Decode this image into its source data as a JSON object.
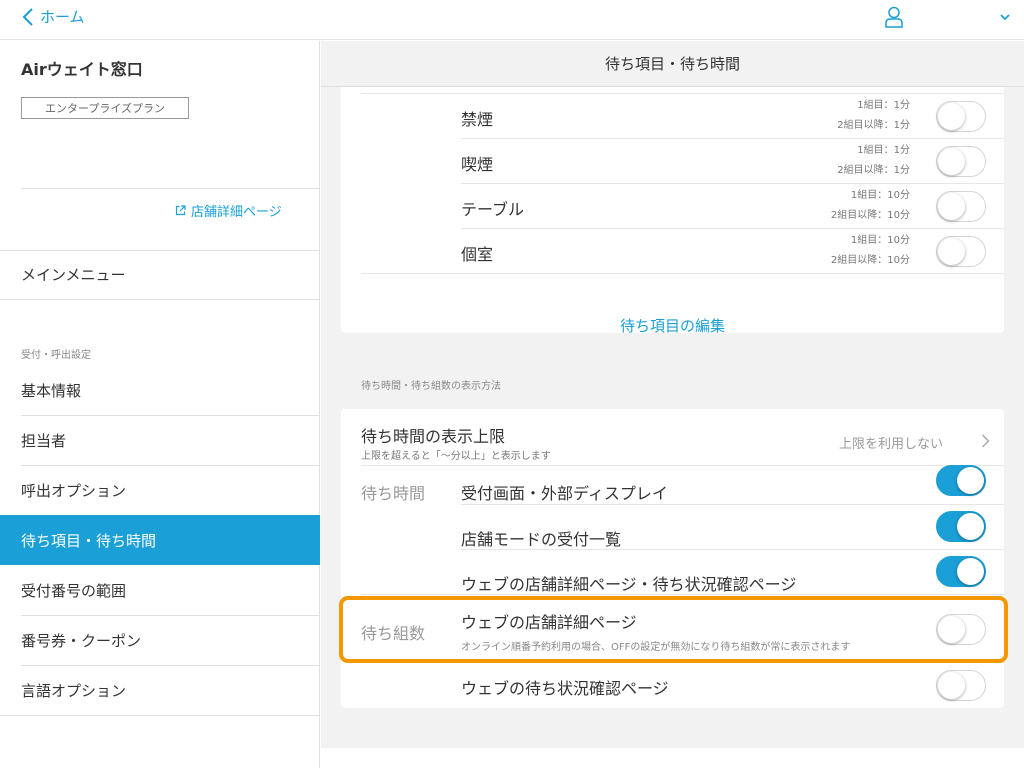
{
  "topbar": {
    "back_label": "ホーム"
  },
  "sidebar": {
    "shop_name": "Airウェイト窓口",
    "plan_badge": "エンタープライズプラン",
    "detail_link": "店舗詳細ページ",
    "main_menu": "メインメニュー",
    "section_label": "受付・呼出設定",
    "items": [
      {
        "label": "基本情報"
      },
      {
        "label": "担当者"
      },
      {
        "label": "呼出オプション"
      },
      {
        "label": "待ち項目・待ち時間"
      },
      {
        "label": "受付番号の範囲"
      },
      {
        "label": "番号券・クーポン"
      },
      {
        "label": "言語オプション"
      }
    ],
    "active_index": 3
  },
  "content": {
    "header": "待ち項目・待ち時間",
    "wait_items": [
      {
        "name": "禁煙",
        "line1": "1組目：1分",
        "line2": "2組目以降：1分",
        "enabled": false
      },
      {
        "name": "喫煙",
        "line1": "1組目：1分",
        "line2": "2組目以降：1分",
        "enabled": false
      },
      {
        "name": "テーブル",
        "line1": "1組目：10分",
        "line2": "2組目以降：10分",
        "enabled": false
      },
      {
        "name": "個室",
        "line1": "1組目：10分",
        "line2": "2組目以降：10分",
        "enabled": false
      }
    ],
    "edit_link": "待ち項目の編集",
    "display_section_label": "待ち時間・待ち組数の表示方法",
    "limit": {
      "title": "待ち時間の表示上限",
      "subtitle": "上限を超えると「〜分以上」と表示します",
      "value": "上限を利用しない"
    },
    "wait_time": {
      "label": "待ち時間",
      "rows": [
        {
          "label": "受付画面・外部ディスプレイ",
          "enabled": true
        },
        {
          "label": "店舗モードの受付一覧",
          "enabled": true
        },
        {
          "label": "ウェブの店舗詳細ページ・待ち状況確認ページ",
          "enabled": true
        }
      ]
    },
    "wait_groups": {
      "label": "待ち組数",
      "rows": [
        {
          "label": "ウェブの店舗詳細ページ",
          "note": "オンライン順番予約利用の場合、OFFの設定が無効になり待ち組数が常に表示されます",
          "enabled": false
        },
        {
          "label": "ウェブの待ち状況確認ページ",
          "enabled": false
        }
      ]
    }
  },
  "colors": {
    "accent": "#1a9fd6",
    "highlight": "#f39800",
    "background": "#f2f2f2"
  }
}
